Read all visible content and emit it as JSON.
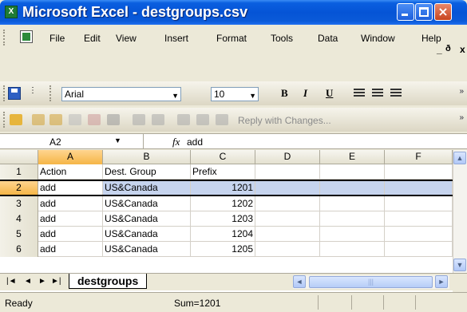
{
  "window": {
    "app_icon_label": "X",
    "title": "Microsoft Excel - destgroups.csv",
    "close_glyph": "×"
  },
  "menu": {
    "items": [
      "File",
      "Edit",
      "View",
      "Insert",
      "Format",
      "Tools",
      "Data",
      "Window",
      "Help"
    ],
    "mdi_min": "_",
    "mdi_restore": "🗗",
    "mdi_close": "x"
  },
  "format_toolbar": {
    "font": "Arial",
    "size": "10",
    "bold": "B",
    "italic": "I",
    "underline": "U"
  },
  "review_toolbar": {
    "reply_label": "Reply with Changes..."
  },
  "formula_bar": {
    "name_box": "A2",
    "fx": "fx",
    "value": "add"
  },
  "grid": {
    "columns": [
      "A",
      "B",
      "C",
      "D",
      "E",
      "F"
    ],
    "active_column": "A",
    "rows": [
      {
        "num": "1",
        "cells": [
          "Action",
          "Dest. Group",
          "Prefix",
          "",
          "",
          ""
        ]
      },
      {
        "num": "2",
        "cells": [
          "add",
          "US&Canada",
          "1201",
          "",
          "",
          ""
        ]
      },
      {
        "num": "3",
        "cells": [
          "add",
          "US&Canada",
          "1202",
          "",
          "",
          ""
        ]
      },
      {
        "num": "4",
        "cells": [
          "add",
          "US&Canada",
          "1203",
          "",
          "",
          ""
        ]
      },
      {
        "num": "5",
        "cells": [
          "add",
          "US&Canada",
          "1204",
          "",
          "",
          ""
        ]
      },
      {
        "num": "6",
        "cells": [
          "add",
          "US&Canada",
          "1205",
          "",
          "",
          ""
        ]
      }
    ],
    "selected_row": "2"
  },
  "sheet_tabs": {
    "active": "destgroups"
  },
  "status": {
    "text": "Ready",
    "sum": "Sum=1201"
  },
  "colors": {
    "titlebar": "#0554d6",
    "selection": "#c6d4ee",
    "active_header": "#f5b547"
  }
}
